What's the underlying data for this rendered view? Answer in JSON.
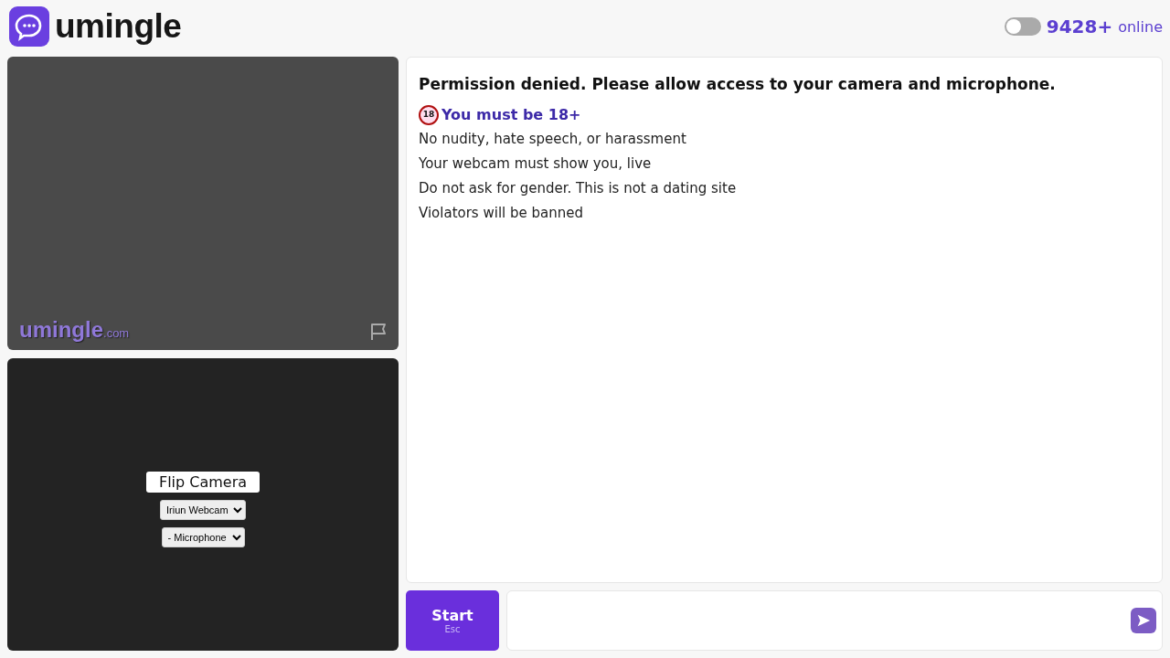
{
  "header": {
    "logo_text": "umingle",
    "toggle": {
      "on": false
    },
    "online_count": "9428+",
    "online_label": "online"
  },
  "remote_video": {
    "watermark": "umingle",
    "watermark_suffix": ".com"
  },
  "local_video": {
    "flip_button": "Flip Camera",
    "camera_select": "Iriun Webcam",
    "microphone_select": "- Microphone"
  },
  "chat": {
    "error": "Permission denied. Please allow access to your camera and microphone.",
    "age_badge": "18",
    "age_notice": "You must be 18+",
    "rules": [
      "No nudity, hate speech, or harassment",
      "Your webcam must show you, live",
      "Do not ask for gender. This is not a dating site",
      "Violators will be banned"
    ]
  },
  "start_button": {
    "label": "Start",
    "shortcut": "Esc"
  }
}
